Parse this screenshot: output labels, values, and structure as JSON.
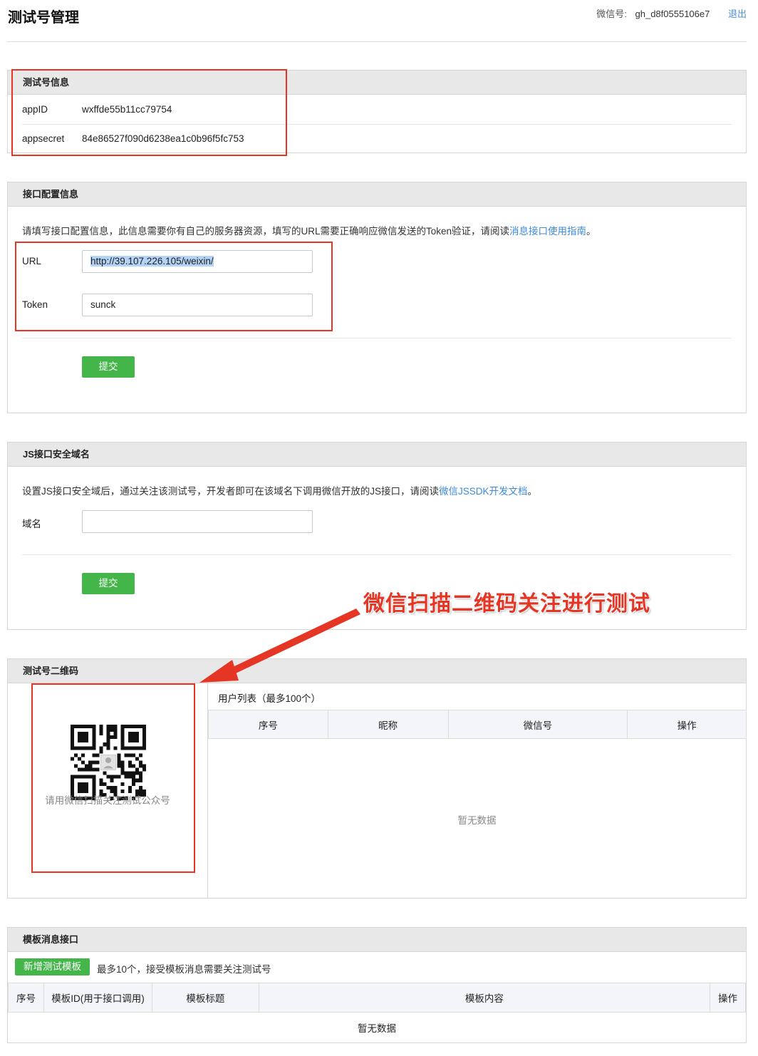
{
  "header": {
    "title": "测试号管理",
    "wechat_label": "微信号:",
    "wechat_id": "gh_d8f0555106e7",
    "logout": "退出"
  },
  "test_account": {
    "heading": "测试号信息",
    "appid_label": "appID",
    "appid_value": "wxffde55b11cc79754",
    "appsecret_label": "appsecret",
    "appsecret_value": "84e86527f090d6238ea1c0b96f5fc753"
  },
  "interface_config": {
    "heading": "接口配置信息",
    "desc": "请填写接口配置信息，此信息需要你有自己的服务器资源，填写的URL需要正确响应微信发送的Token验证，请阅读",
    "desc_link": "消息接口使用指南",
    "desc_end": "。",
    "url_label": "URL",
    "url_value": "http://39.107.226.105/weixin/",
    "token_label": "Token",
    "token_value": "sunck",
    "submit": "提交"
  },
  "js_domain": {
    "heading": "JS接口安全域名",
    "desc": "设置JS接口安全域后，通过关注该测试号，开发者即可在该域名下调用微信开放的JS接口，请阅读",
    "desc_link": "微信JSSDK开发文档",
    "desc_end": "。",
    "domain_label": "域名",
    "domain_value": "",
    "submit": "提交"
  },
  "annotation": "微信扫描二维码关注进行测试",
  "qrcode": {
    "heading": "测试号二维码",
    "caption": "请用微信扫描关注测试公众号",
    "user_list_title": "用户列表（最多100个）",
    "columns": [
      "序号",
      "昵称",
      "微信号",
      "操作"
    ],
    "empty": "暂无数据"
  },
  "template": {
    "heading": "模板消息接口",
    "add_button": "新增测试模板",
    "note": "最多10个，接受模板消息需要关注测试号",
    "columns": [
      "序号",
      "模板ID(用于接口调用)",
      "模板标题",
      "模板内容",
      "操作"
    ],
    "empty": "暂无数据"
  },
  "colors": {
    "accent_green": "#44b549",
    "link_blue": "#3f8ad8",
    "annotation_red": "#e53524"
  }
}
